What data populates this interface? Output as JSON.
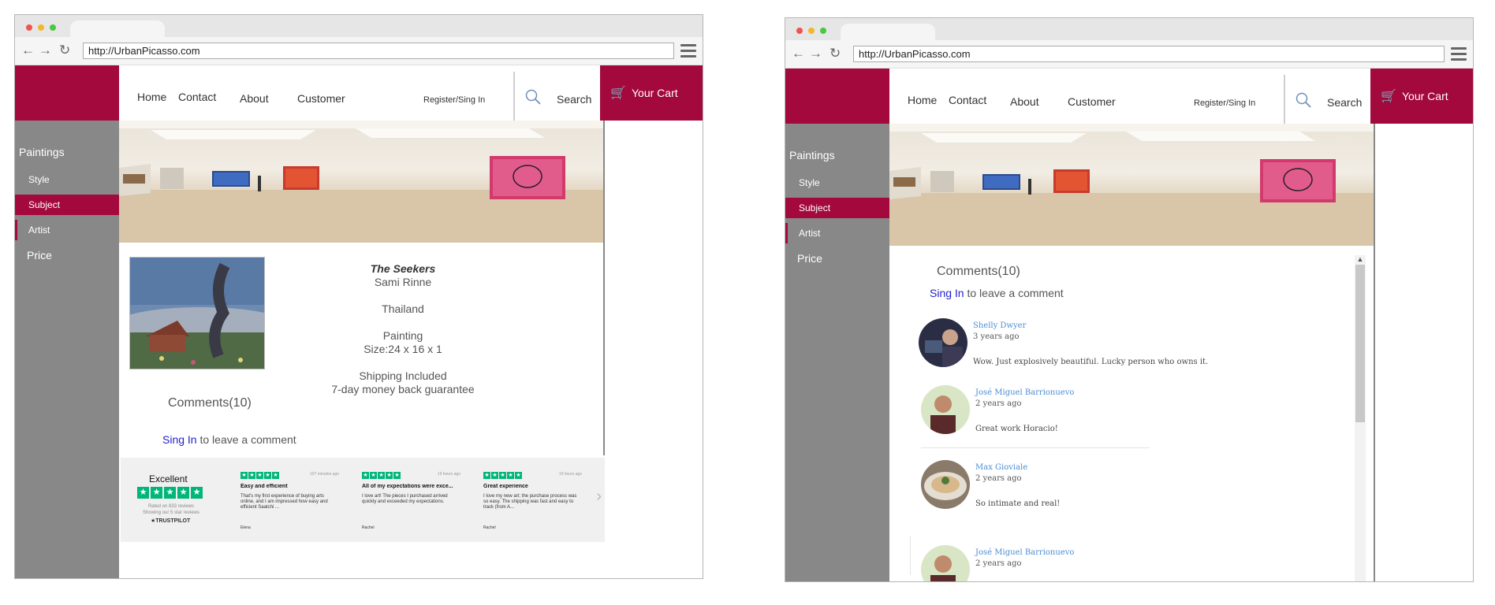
{
  "browser": {
    "url": "http://UrbanPicasso.com"
  },
  "nav": {
    "home": "Home",
    "contact": "Contact",
    "about": "About",
    "customer": "Customer",
    "register": "Register/Sing In",
    "search": "Search",
    "cart": "Your Cart"
  },
  "sidebar": {
    "title": "Paintings",
    "items": [
      "Style",
      "Subject",
      "Artist"
    ],
    "price": "Price",
    "active": "Subject"
  },
  "product": {
    "title": "The Seekers",
    "artist": "Sami Rinne",
    "country": "Thailand",
    "medium": "Painting",
    "size": "Size:24 x 16 x 1",
    "shipping": "Shipping Included",
    "guarantee": "7-day money back guarantee"
  },
  "comments": {
    "title": "Comments(10)",
    "sign_in": "Sing In",
    "sign_in_suffix": "to leave a comment",
    "list": [
      {
        "name": "Shelly Dwyer",
        "time": "3 years ago",
        "text": "Wow. Just explosively beautiful. Lucky person who owns it."
      },
      {
        "name": "José Miguel Barrionuevo",
        "time": "2 years ago",
        "text": "Great work Horacio!"
      },
      {
        "name": "Max Gioviale",
        "time": "2 years ago",
        "text": "So intimate and real!"
      },
      {
        "name": "José Miguel Barrionuevo",
        "time": "2 years ago",
        "text": ""
      }
    ]
  },
  "trustpilot": {
    "rating": "Excellent",
    "rated": "Rated on 833 reviews",
    "showing": "Showing our 5 star reviews",
    "logo": "TRUSTPILOT",
    "reviews": [
      {
        "time": "107 minutes ago",
        "title": "Easy and efficient",
        "body": "That's my first experience of buying arts online, and I am impressed how easy and efficient Saatchi ...",
        "author": "Elena"
      },
      {
        "time": "19 hours ago",
        "title": "All of my expectations were exce...",
        "body": "I love art! The pieces I purchased arrived quickly and exceeded my expectations.",
        "author": "Rachel"
      },
      {
        "time": "19 hours ago",
        "title": "Great experience",
        "body": "I love my new art; the purchase process was so easy. The shipping was fast and easy to track (from A...",
        "author": "Rachel"
      }
    ]
  },
  "colors": {
    "brand": "#a3093c",
    "sidebar": "#888888",
    "link": "#2222cc",
    "trustpilot": "#00b67a"
  },
  "icons": [
    "back-arrow-icon",
    "forward-arrow-icon",
    "reload-icon",
    "hamburger-menu-icon",
    "search-icon",
    "cart-icon",
    "star-icon",
    "chevron-right-icon"
  ]
}
